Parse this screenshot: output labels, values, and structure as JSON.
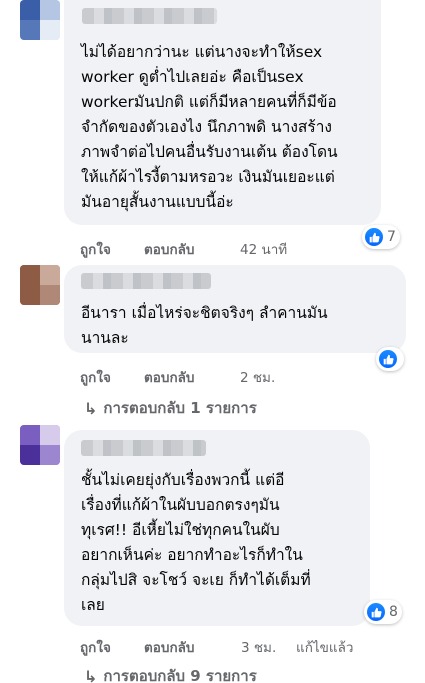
{
  "comments": [
    {
      "text": "ไม่ได้อยากว่านะ แต่นางจะทำให้sex\nworker ดูต่ำไปเลยอ่ะ คือเป็นsex\nworkerมันปกติ แต่ก็มีหลายคนที่ก็มีข้อ\nจำกัดของตัวเองไง นึกภาพดิ นางสร้าง\nภาพจำต่อไปคนอื่นรับงานเต้น ต้องโดน\nให้แก้ผ้าไรงี้ตามหรอวะ เงินมันเยอะแต่\nมันอายุสั้นงานแบบนี้อ่ะ",
      "like_label": "ถูกใจ",
      "reply_label": "ตอบกลับ",
      "time": "42 นาที",
      "reaction_count": "7",
      "reaction_icon": "like-icon"
    },
    {
      "text": "อีนารา เมื่อไหร่จะชิตจริงๆ ลำคานมัน\nนานละ",
      "like_label": "ถูกใจ",
      "reply_label": "ตอบกลับ",
      "time": "2 ชม.",
      "reaction_count": "",
      "reaction_icon": "like-icon",
      "replies_label": "การตอบกลับ 1 รายการ"
    },
    {
      "text": "ชั้นไม่เคยยุ่งกับเรื่องพวกนี้ แต่อี\nเรื่องที่แก้ผ้าในผับบอกตรงๆมัน\nทุเรศ!! อีเหี้ยไม่ใช่ทุกคนในผับ\nอยากเห็นค่ะ อยากทำอะไรก็ทำใน\nกลุ่มไปสิ จะโชว์ จะเย ก็ทำได้เต็มที่\nเลย",
      "like_label": "ถูกใจ",
      "reply_label": "ตอบกลับ",
      "time": "3 ชม.",
      "edited_label": "แก้ไขแล้ว",
      "reaction_count": "8",
      "reaction_icon": "like-icon",
      "replies_label": "การตอบกลับ 9 รายการ"
    }
  ],
  "colors": {
    "bubble": "#f0f2f5",
    "meta_text": "#65676b",
    "like_blue": "#0866ff"
  }
}
